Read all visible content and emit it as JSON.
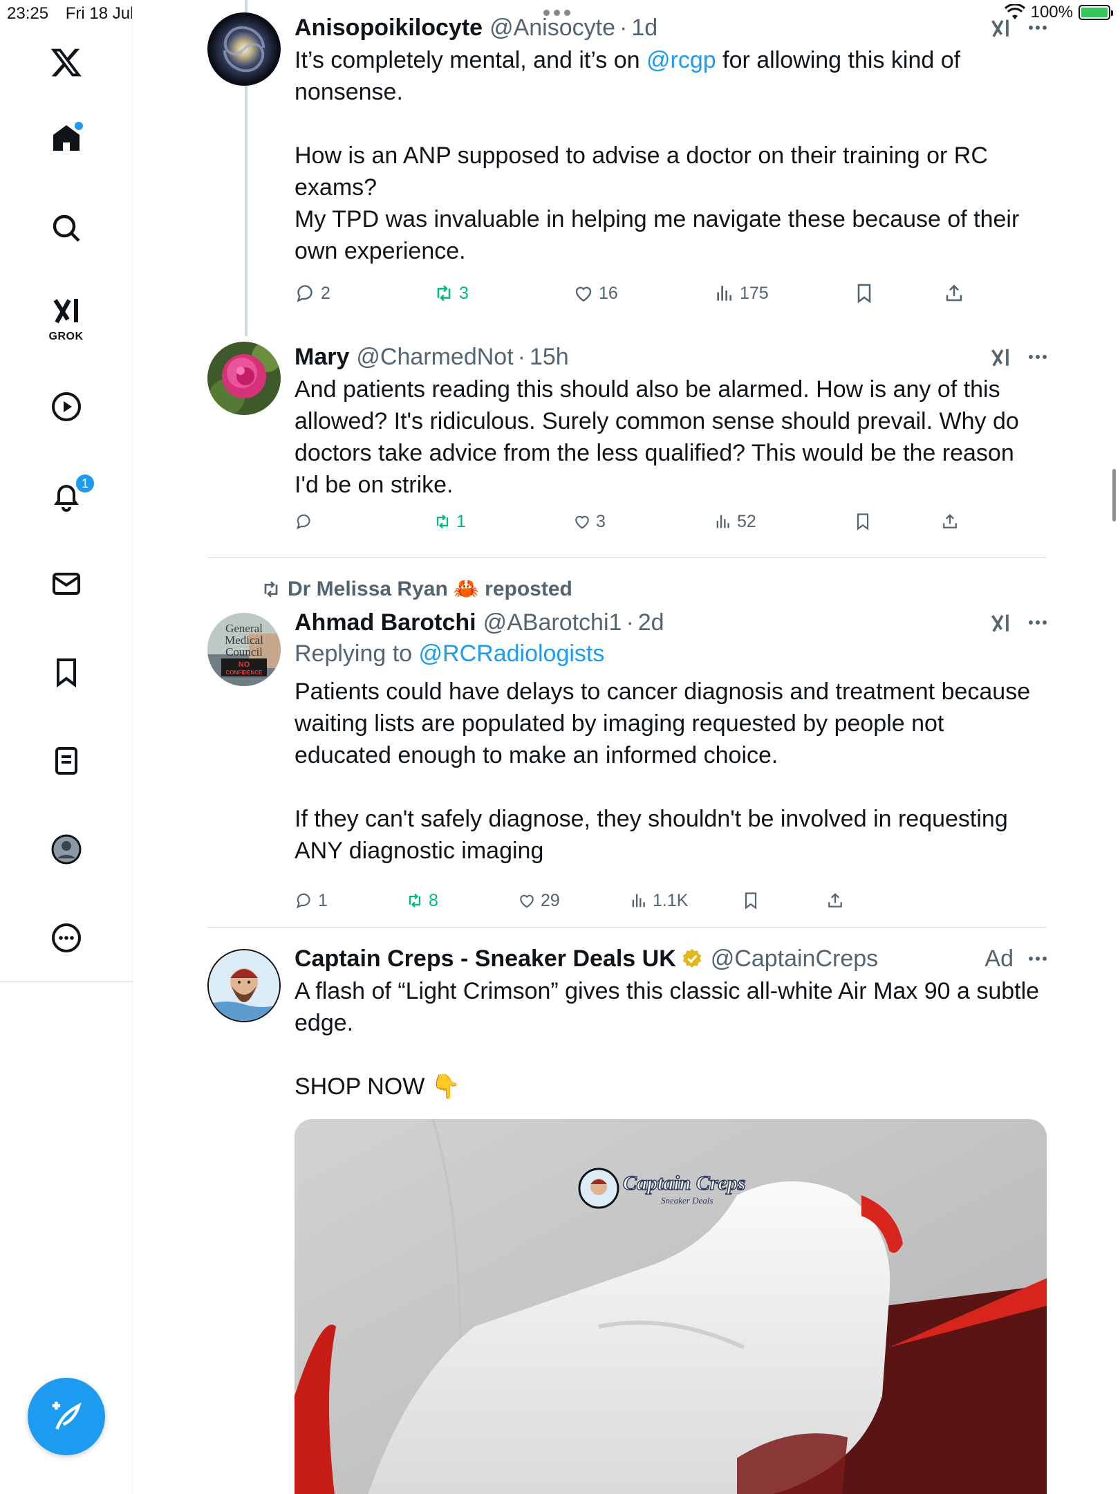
{
  "status": {
    "time": "23:25",
    "date": "Fri 18 Jul",
    "battery": "100%"
  },
  "sidebar": {
    "grok_label": "GROK",
    "notifications_count": "1"
  },
  "tweets": [
    {
      "name": "Anisopoikilocyte",
      "handle": "@Anisocyte",
      "sep": "·",
      "time": "1d",
      "text_line1_pre": "It’s completely mental, and it’s on ",
      "mention": "@rcgp",
      "text_line1_post": " for allowing this kind of nonsense.",
      "text_para2": "How is an ANP supposed to advise a doctor on their training or RC exams?",
      "text_para3": "My TPD was invaluable in helping me navigate these because of their own experience.",
      "replies": "2",
      "reposts": "3",
      "likes": "16",
      "views": "175"
    },
    {
      "name": "Mary",
      "handle": "@CharmedNot",
      "sep": "·",
      "time": "15h",
      "text": "And patients reading this should also be alarmed.  How is any of this allowed?  It's ridiculous.   Surely common sense should prevail.  Why do doctors take advice from the less qualified?  This would be the reason I'd be on strike.",
      "replies": "",
      "reposts": "1",
      "likes": "3",
      "views": "52"
    },
    {
      "reposted_by": "Dr Melissa Ryan",
      "reposted_emoji": "🦀",
      "reposted_label": "reposted",
      "name": "Ahmad Barotchi",
      "handle": "@ABarotchi1",
      "sep": "·",
      "time": "2d",
      "replying_label": "Replying to ",
      "replying_to": "@RCRadiologists",
      "text_para1": "Patients could have delays to cancer diagnosis and treatment because waiting lists are populated by imaging requested by people not educated enough to make an informed choice.",
      "text_para2": "If they can't safely diagnose, they shouldn't be involved in requesting ANY diagnostic imaging",
      "avatar_text": [
        "General",
        "Medical",
        "Council",
        "NO",
        "CONFIDENCE"
      ],
      "replies": "1",
      "reposts": "8",
      "likes": "29",
      "views": "1.1K"
    },
    {
      "name": "Captain Creps - Sneaker Deals UK",
      "handle": "@CaptainCreps",
      "ad_label": "Ad",
      "text_para1": "A flash of “Light Crimson” gives this classic all-white Air Max 90 a subtle edge.",
      "text_para2": "SHOP NOW 👇",
      "image_logo_text": "Captain Creps",
      "image_logo_sub": "Sneaker Deals"
    }
  ],
  "colors": {
    "accent": "#1d9bf0",
    "repost_green": "#00ba7c",
    "secondary_text": "#536471",
    "divider": "#cfd9de"
  }
}
